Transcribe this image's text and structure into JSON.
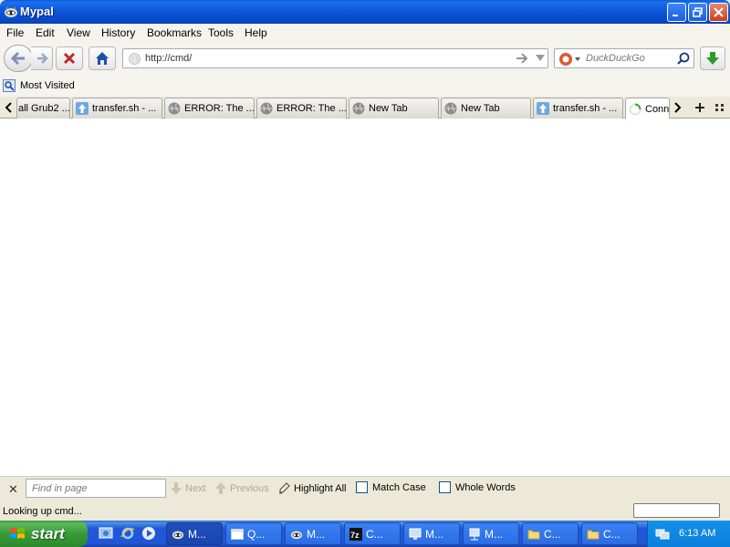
{
  "window": {
    "title": "Mypal"
  },
  "menu": [
    "File",
    "Edit",
    "View",
    "History",
    "Bookmarks",
    "Tools",
    "Help"
  ],
  "nav": {
    "url": "http://cmd/",
    "search_placeholder": "DuckDuckGo"
  },
  "bookmarks": [
    {
      "label": "Most Visited"
    }
  ],
  "tabs": [
    {
      "label": "all Grub2 ...",
      "icon": "none",
      "active": false
    },
    {
      "label": "transfer.sh - ...",
      "icon": "transfer-icon",
      "active": false
    },
    {
      "label": "ERROR: The ...",
      "icon": "globe-icon",
      "active": false
    },
    {
      "label": "ERROR: The ...",
      "icon": "globe-icon",
      "active": false
    },
    {
      "label": "New Tab",
      "icon": "globe-icon",
      "active": false
    },
    {
      "label": "New Tab",
      "icon": "globe-icon",
      "active": false
    },
    {
      "label": "transfer.sh - ...",
      "icon": "transfer-icon",
      "active": false
    },
    {
      "label": "Conn",
      "icon": "loading-spinner-icon",
      "active": true
    }
  ],
  "findbar": {
    "placeholder": "Find in page",
    "next": "Next",
    "previous": "Previous",
    "highlight_all": "Highlight All",
    "match_case": "Match Case",
    "whole_words": "Whole Words"
  },
  "status": {
    "text": "Looking up cmd..."
  },
  "taskbar": {
    "start_label": "start",
    "quick_launch": [
      "show-desktop-icon",
      "internet-explorer-icon",
      "media-player-icon"
    ],
    "tasks": [
      {
        "label": "M...",
        "icon": "mypal-icon",
        "active": true
      },
      {
        "label": "Q...",
        "icon": "window-icon",
        "active": false
      },
      {
        "label": "M...",
        "icon": "mypal-icon",
        "active": false
      },
      {
        "label": "C...",
        "icon": "7zip-icon",
        "active": false
      },
      {
        "label": "M...",
        "icon": "monitor-icon",
        "active": false
      },
      {
        "label": "M...",
        "icon": "network-icon",
        "active": false
      },
      {
        "label": "C...",
        "icon": "folder-icon",
        "active": false
      },
      {
        "label": "C...",
        "icon": "folder-icon",
        "active": false
      }
    ],
    "clock": "6:13 AM"
  },
  "colors": {
    "titlebar": "#0b54d6",
    "taskbar": "#2157d7",
    "start": "#389938",
    "download_arrow": "#2a9d2a",
    "stop_x": "#c0282a"
  }
}
